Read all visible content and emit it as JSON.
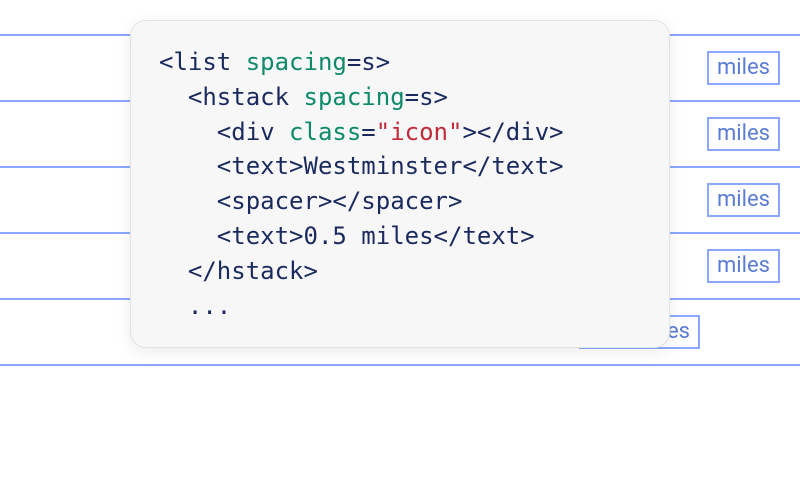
{
  "background": {
    "rows": [
      {
        "label": "miles"
      },
      {
        "label": "miles"
      },
      {
        "label": "miles"
      },
      {
        "label": "miles"
      },
      {
        "label": "10.5 miles"
      }
    ]
  },
  "code": {
    "lines": [
      [
        {
          "cls": "tag",
          "t": "<list "
        },
        {
          "cls": "attr",
          "t": "spacing"
        },
        {
          "cls": "eq",
          "t": "=s>"
        }
      ],
      [
        {
          "cls": "tag",
          "t": "  <hstack "
        },
        {
          "cls": "attr",
          "t": "spacing"
        },
        {
          "cls": "eq",
          "t": "=s>"
        }
      ],
      [
        {
          "cls": "tag",
          "t": "    <div "
        },
        {
          "cls": "attr",
          "t": "class"
        },
        {
          "cls": "eq",
          "t": "="
        },
        {
          "cls": "val",
          "t": "\"icon\""
        },
        {
          "cls": "tag",
          "t": "></div>"
        }
      ],
      [
        {
          "cls": "tag",
          "t": "    <text>"
        },
        {
          "cls": "text",
          "t": "Westminster"
        },
        {
          "cls": "tag",
          "t": "</text>"
        }
      ],
      [
        {
          "cls": "tag",
          "t": "    <spacer></spacer>"
        }
      ],
      [
        {
          "cls": "tag",
          "t": "    <text>"
        },
        {
          "cls": "text",
          "t": "0.5 miles"
        },
        {
          "cls": "tag",
          "t": "</text>"
        }
      ],
      [
        {
          "cls": "tag",
          "t": "  </hstack>"
        }
      ],
      [
        {
          "cls": "ellip",
          "t": "  ..."
        }
      ]
    ]
  }
}
